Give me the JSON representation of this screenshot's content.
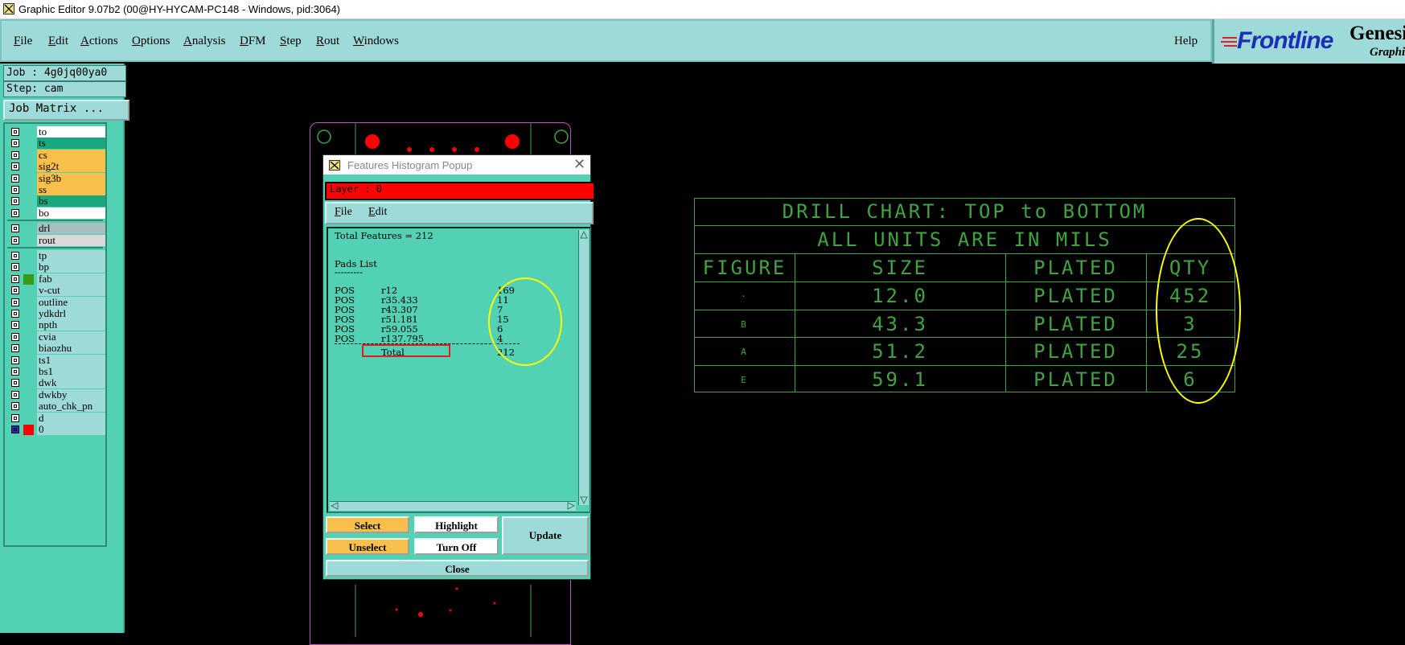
{
  "window": {
    "title": "Graphic Editor 9.07b2 (00@HY-HYCAM-PC148 - Windows, pid:3064)"
  },
  "menu": [
    {
      "label": "File",
      "ul": "F",
      "rest": "ile"
    },
    {
      "label": "Edit",
      "ul": "E",
      "rest": "dit"
    },
    {
      "label": "Actions",
      "ul": "A",
      "rest": "ctions"
    },
    {
      "label": "Options",
      "ul": "O",
      "rest": "ptions"
    },
    {
      "label": "Analysis",
      "ul": "A",
      "rest": "nalysis"
    },
    {
      "label": "DFM",
      "ul": "D",
      "rest": "FM"
    },
    {
      "label": "Step",
      "ul": "S",
      "rest": "tep"
    },
    {
      "label": "Rout",
      "ul": "R",
      "rest": "out"
    },
    {
      "label": "Windows",
      "ul": "W",
      "rest": "indows"
    }
  ],
  "help": "Help",
  "logo": {
    "brand": "Frontline",
    "product": "Genesi",
    "sub": "Graphic"
  },
  "job": {
    "job": "Job : 4g0jq00ya0",
    "step": "Step: cam",
    "matrix_button": "Job Matrix ..."
  },
  "layers": [
    {
      "name": "to",
      "bg": "#ffffff"
    },
    {
      "name": "ts",
      "bg": "#19a77e"
    },
    {
      "name": "cs",
      "bg": "#f8c04a"
    },
    {
      "name": "sig2t",
      "bg": "#f8c04a"
    },
    {
      "name": "sig3b",
      "bg": "#f8c04a"
    },
    {
      "name": "ss",
      "bg": "#f8c04a"
    },
    {
      "name": "bs",
      "bg": "#19a77e"
    },
    {
      "name": "bo",
      "bg": "#ffffff"
    },
    {
      "name": "drl",
      "bg": "#a7bfbe"
    },
    {
      "name": "rout",
      "bg": "#d9d9d9"
    },
    {
      "name": "tp",
      "bg": "#9edbd8"
    },
    {
      "name": "bp",
      "bg": "#9edbd8"
    },
    {
      "name": "fab",
      "bg": "#9edbd8"
    },
    {
      "name": "v-cut",
      "bg": "#9edbd8"
    },
    {
      "name": "outline",
      "bg": "#9edbd8"
    },
    {
      "name": "ydkdrl",
      "bg": "#9edbd8"
    },
    {
      "name": "npth",
      "bg": "#9edbd8"
    },
    {
      "name": "cvia",
      "bg": "#9edbd8"
    },
    {
      "name": "biaozhu",
      "bg": "#9edbd8"
    },
    {
      "name": "ts1",
      "bg": "#9edbd8"
    },
    {
      "name": "bs1",
      "bg": "#9edbd8"
    },
    {
      "name": "dwk",
      "bg": "#9edbd8"
    },
    {
      "name": "dwkby",
      "bg": "#9edbd8"
    },
    {
      "name": "auto_chk_pn",
      "bg": "#9edbd8"
    },
    {
      "name": "d",
      "bg": "#9edbd8"
    },
    {
      "name": "0",
      "bg": "#9edbd8"
    }
  ],
  "popup": {
    "title": "Features Histogram Popup",
    "layer": "Layer :  0",
    "menu": [
      "File",
      "Edit"
    ],
    "total_features": "Total Features = 212",
    "pads_title": "Pads List",
    "pads_rule": "---------",
    "pads": [
      {
        "pol": "POS",
        "sym": "r12",
        "count": "169"
      },
      {
        "pol": "POS",
        "sym": "r35.433",
        "count": "11"
      },
      {
        "pol": "POS",
        "sym": "r43.307",
        "count": "7"
      },
      {
        "pol": "POS",
        "sym": "r51.181",
        "count": "15"
      },
      {
        "pol": "POS",
        "sym": "r59.055",
        "count": "6"
      },
      {
        "pol": "POS",
        "sym": "r137.795",
        "count": "4"
      }
    ],
    "total_label": "Total",
    "total_value": "212",
    "buttons": {
      "select": "Select",
      "highlight": "Highlight",
      "unselect": "Unselect",
      "turnoff": "Turn Off",
      "update": "Update",
      "close": "Close"
    }
  },
  "drill_chart": {
    "title": "DRILL CHART: TOP to BOTTOM",
    "subtitle": "ALL UNITS ARE IN MILS",
    "headers": [
      "FIGURE",
      "SIZE",
      "PLATED",
      "QTY"
    ],
    "rows": [
      {
        "figure": "·",
        "size": "12.0",
        "plated": "PLATED",
        "qty": "452"
      },
      {
        "figure": "B",
        "size": "43.3",
        "plated": "PLATED",
        "qty": "3"
      },
      {
        "figure": "A",
        "size": "51.2",
        "plated": "PLATED",
        "qty": "25"
      },
      {
        "figure": "E",
        "size": "59.1",
        "plated": "PLATED",
        "qty": "6"
      }
    ]
  },
  "colors": {
    "panel": "#52d1b4",
    "menu": "#9edbd8",
    "highlight": "#ffff00",
    "chart": "#3fa33f",
    "layer_bar": "#ff0000"
  }
}
